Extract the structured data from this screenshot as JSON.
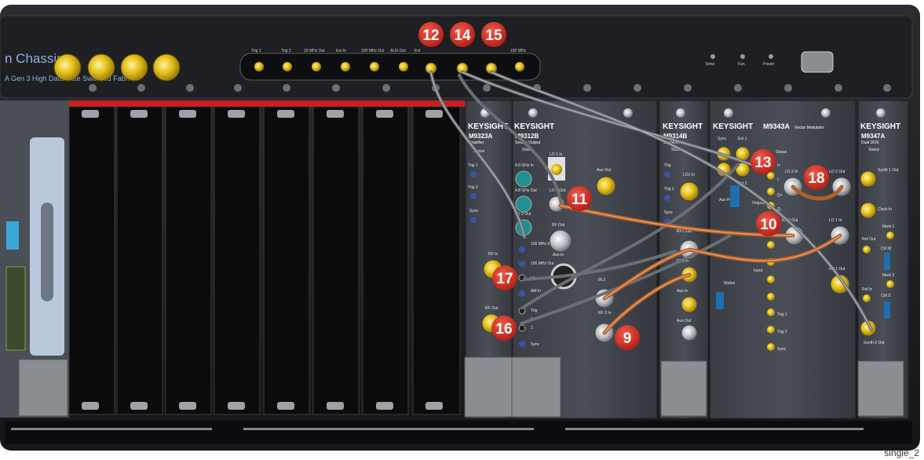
{
  "chassis": {
    "title_fragment": "n Chassis",
    "subtitle_fragment": "A   Gen 3 High Data Rate Switched Fabric",
    "indicators": [
      "Temp",
      "Fan",
      "Power"
    ],
    "front_ports": [
      "Trig 1",
      "Trig 2",
      "10 MHz Out",
      "Ext In",
      "100 MHz Out",
      "AUX Out",
      "Ext",
      "100 MHz"
    ]
  },
  "callouts": [
    "12",
    "14",
    "15",
    "13",
    "18",
    "11",
    "10",
    "17",
    "16",
    "9"
  ],
  "modules": {
    "amp": {
      "brand": "KEYSIGHT",
      "model": "M9323A",
      "type": "Amplifier",
      "labels": [
        "Status",
        "Trig 1",
        "Trig 2",
        "Sync",
        "RF In",
        "RF Out"
      ]
    },
    "source": {
      "brand": "KEYSIGHT",
      "model": "M9312B",
      "type": "Source Output",
      "labels": [
        "Status",
        "LO 1 In",
        "4.8 GHz In",
        "4.8 GHz Out",
        "LO 1 Out",
        "Aux Out",
        "LO 2 Out",
        "RF Out",
        "100 MHz In",
        "100 MHz Out",
        "LF",
        "Aux In",
        "AM In",
        "Trig",
        "1",
        "2",
        "Sync"
      ]
    },
    "upconv": {
      "brand": "KEYSIGHT",
      "model": "M9314B",
      "type": "Upconverter",
      "labels": [
        "Status",
        "Trig",
        "LO1 In",
        "Trig 2",
        "Sync",
        "RF1 Out",
        "RF1 In",
        "Aux In",
        "Aux Out",
        "IN 2",
        "RF 2 In"
      ]
    },
    "vecmod": {
      "brand": "KEYSIGHT",
      "model": "M9343A",
      "type": "Vector Modulator",
      "labels": [
        "Sync",
        "Ext 1",
        "Ext 2",
        "Status",
        "LO 2 In",
        "LO 2 Out",
        "I+",
        "I-",
        "Q+",
        "Q-",
        "Output",
        "Aux Port",
        "RF 2 Out",
        "LO 1 In",
        "RF 1 Out",
        "Input",
        "Status",
        "Trig 1",
        "Trig 2",
        "Sync"
      ]
    },
    "dds": {
      "brand": "KEYSIGHT",
      "model": "M9347A",
      "type": "Dual DDS",
      "labels": [
        "Status",
        "Synth 1 Out",
        "Clock In",
        "Mark 1",
        "Ref Out",
        "Ctrl M",
        "Mark 2",
        "Ref In",
        "Ctrl S",
        "Synth 2 Out"
      ]
    }
  },
  "image_caption": "single_2"
}
